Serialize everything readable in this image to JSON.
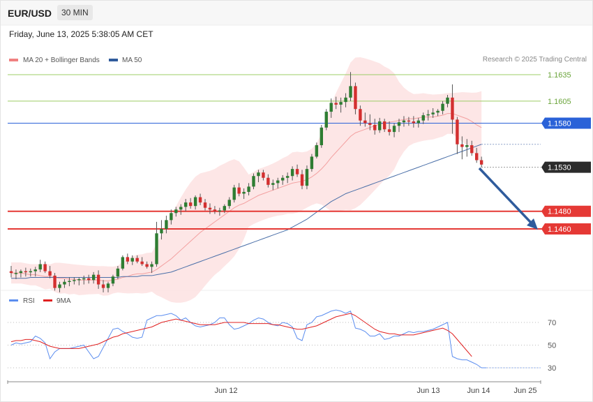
{
  "header": {
    "symbol": "EUR/USD",
    "timeframe": "30 MIN",
    "datetime": "Friday, June 13, 2025 5:38:05 AM CET"
  },
  "price_panel": {
    "legend": {
      "ma20": {
        "label": "MA 20 + Bollinger Bands",
        "color": "#f08080"
      },
      "ma50": {
        "label": "MA 50",
        "color": "#2f5b9c"
      }
    },
    "credit": "Research © 2025 Trading Central"
  },
  "rsi_panel": {
    "legend": {
      "rsi": {
        "label": "RSI",
        "color": "#5b8def"
      },
      "ma9": {
        "label": "9MA",
        "color": "#e02020"
      }
    }
  },
  "colors": {
    "up_candle": "#2e7d32",
    "down_candle": "#d32f2f",
    "band_fill": "#fde3e3",
    "resistance_green": "#9ccc65",
    "pivot_blue": "#2a62d8",
    "support_red": "#e53935",
    "last_price_bg": "#2b2b2b",
    "forecast_arrow": "#2f5b9c"
  },
  "chart_data": [
    {
      "type": "candlestick",
      "title": "EUR/USD 30 MIN",
      "price_levels": [
        {
          "value": 1.1635,
          "label": "1.1635",
          "style": "resistance",
          "color": "#9ccc65"
        },
        {
          "value": 1.1605,
          "label": "1.1605",
          "style": "resistance",
          "color": "#9ccc65"
        },
        {
          "value": 1.158,
          "label": "1.1580",
          "style": "pivot",
          "color": "#2a62d8"
        },
        {
          "value": 1.153,
          "label": "1.1530",
          "style": "last",
          "color": "#2b2b2b"
        },
        {
          "value": 1.148,
          "label": "1.1480",
          "style": "support",
          "color": "#e53935"
        },
        {
          "value": 1.146,
          "label": "1.1460",
          "style": "support",
          "color": "#e53935"
        }
      ],
      "x_labels": [
        "Jun 12",
        "Jun 13",
        "Jun 14",
        "Jun 25"
      ],
      "ylim": [
        1.1415,
        1.1645
      ],
      "ohlc": [
        [
          1.1412,
          1.1418,
          1.1405,
          1.141
        ],
        [
          1.141,
          1.1414,
          1.1403,
          1.141
        ],
        [
          1.141,
          1.1414,
          1.1405,
          1.1412
        ],
        [
          1.1412,
          1.1416,
          1.1406,
          1.1411
        ],
        [
          1.1411,
          1.1415,
          1.1406,
          1.1412
        ],
        [
          1.1412,
          1.1417,
          1.1406,
          1.1414
        ],
        [
          1.1414,
          1.1425,
          1.1411,
          1.142
        ],
        [
          1.142,
          1.1423,
          1.141,
          1.1412
        ],
        [
          1.1412,
          1.1418,
          1.1404,
          1.1407
        ],
        [
          1.1407,
          1.141,
          1.139,
          1.1393
        ],
        [
          1.1393,
          1.14,
          1.1388,
          1.1397
        ],
        [
          1.1397,
          1.1403,
          1.1393,
          1.14
        ],
        [
          1.14,
          1.1405,
          1.1395,
          1.1401
        ],
        [
          1.1401,
          1.1405,
          1.1397,
          1.1402
        ],
        [
          1.1402,
          1.1405,
          1.1396,
          1.1403
        ],
        [
          1.1403,
          1.1407,
          1.1397,
          1.1404
        ],
        [
          1.1404,
          1.1408,
          1.1398,
          1.1402
        ],
        [
          1.1402,
          1.1411,
          1.1398,
          1.1408
        ],
        [
          1.1408,
          1.1413,
          1.1392,
          1.1397
        ],
        [
          1.1397,
          1.1402,
          1.1388,
          1.1393
        ],
        [
          1.1393,
          1.14,
          1.1388,
          1.1398
        ],
        [
          1.1398,
          1.1408,
          1.1395,
          1.1406
        ],
        [
          1.1406,
          1.1418,
          1.1403,
          1.1415
        ],
        [
          1.1415,
          1.143,
          1.1413,
          1.1428
        ],
        [
          1.1428,
          1.1432,
          1.142,
          1.1423
        ],
        [
          1.1423,
          1.143,
          1.1419,
          1.1427
        ],
        [
          1.1427,
          1.143,
          1.1421,
          1.1423
        ],
        [
          1.1423,
          1.1428,
          1.1418,
          1.142
        ],
        [
          1.142,
          1.1423,
          1.1415,
          1.1417
        ],
        [
          1.1417,
          1.1423,
          1.141,
          1.142
        ],
        [
          1.142,
          1.1468,
          1.1417,
          1.1455
        ],
        [
          1.1455,
          1.147,
          1.1448,
          1.146
        ],
        [
          1.146,
          1.1475,
          1.1455,
          1.147
        ],
        [
          1.147,
          1.1482,
          1.1465,
          1.1478
        ],
        [
          1.1478,
          1.1485,
          1.1474,
          1.1482
        ],
        [
          1.1482,
          1.1488,
          1.1476,
          1.1485
        ],
        [
          1.1485,
          1.1494,
          1.148,
          1.149
        ],
        [
          1.149,
          1.1495,
          1.1483,
          1.1486
        ],
        [
          1.1486,
          1.1498,
          1.1482,
          1.1496
        ],
        [
          1.1496,
          1.15,
          1.1487,
          1.149
        ],
        [
          1.149,
          1.1494,
          1.1481,
          1.1484
        ],
        [
          1.1484,
          1.1489,
          1.1477,
          1.1482
        ],
        [
          1.1482,
          1.1486,
          1.1477,
          1.148
        ],
        [
          1.148,
          1.1484,
          1.1475,
          1.1481
        ],
        [
          1.1481,
          1.1488,
          1.1478,
          1.1486
        ],
        [
          1.1486,
          1.1496,
          1.1483,
          1.1493
        ],
        [
          1.1493,
          1.151,
          1.149,
          1.1507
        ],
        [
          1.1507,
          1.1512,
          1.1497,
          1.15
        ],
        [
          1.15,
          1.1506,
          1.1494,
          1.1502
        ],
        [
          1.1502,
          1.1512,
          1.1498,
          1.1508
        ],
        [
          1.1508,
          1.1523,
          1.1505,
          1.152
        ],
        [
          1.152,
          1.1527,
          1.1513,
          1.1524
        ],
        [
          1.1524,
          1.1527,
          1.1515,
          1.1518
        ],
        [
          1.1518,
          1.1522,
          1.1507,
          1.151
        ],
        [
          1.151,
          1.1516,
          1.1504,
          1.1512
        ],
        [
          1.1512,
          1.1518,
          1.1506,
          1.1515
        ],
        [
          1.1515,
          1.1521,
          1.151,
          1.1518
        ],
        [
          1.1518,
          1.1524,
          1.1512,
          1.152
        ],
        [
          1.152,
          1.1531,
          1.1515,
          1.1528
        ],
        [
          1.1528,
          1.1533,
          1.1519,
          1.1522
        ],
        [
          1.1522,
          1.1527,
          1.1505,
          1.1509
        ],
        [
          1.1509,
          1.1532,
          1.1505,
          1.1528
        ],
        [
          1.1528,
          1.1545,
          1.1525,
          1.1542
        ],
        [
          1.1542,
          1.1558,
          1.154,
          1.1555
        ],
        [
          1.1555,
          1.1578,
          1.1552,
          1.1575
        ],
        [
          1.1575,
          1.1596,
          1.1572,
          1.1593
        ],
        [
          1.1593,
          1.1608,
          1.1586,
          1.1603
        ],
        [
          1.1603,
          1.161,
          1.1596,
          1.1601
        ],
        [
          1.1601,
          1.1609,
          1.1592,
          1.1604
        ],
        [
          1.1604,
          1.1614,
          1.1598,
          1.1609
        ],
        [
          1.1609,
          1.1638,
          1.1605,
          1.1622
        ],
        [
          1.1622,
          1.1626,
          1.159,
          1.1596
        ],
        [
          1.1596,
          1.16,
          1.1577,
          1.1583
        ],
        [
          1.1583,
          1.1592,
          1.1576,
          1.158
        ],
        [
          1.158,
          1.159,
          1.1572,
          1.1578
        ],
        [
          1.1578,
          1.1585,
          1.1567,
          1.1572
        ],
        [
          1.1572,
          1.1586,
          1.1569,
          1.1582
        ],
        [
          1.1582,
          1.1585,
          1.157,
          1.1573
        ],
        [
          1.1573,
          1.1582,
          1.1566,
          1.157
        ],
        [
          1.157,
          1.158,
          1.1564,
          1.1577
        ],
        [
          1.1577,
          1.1585,
          1.157,
          1.1581
        ],
        [
          1.1581,
          1.1588,
          1.1576,
          1.1583
        ],
        [
          1.1583,
          1.1587,
          1.1577,
          1.1582
        ],
        [
          1.1582,
          1.1588,
          1.1575,
          1.158
        ],
        [
          1.158,
          1.1586,
          1.1575,
          1.1583
        ],
        [
          1.1583,
          1.1592,
          1.1579,
          1.1589
        ],
        [
          1.1589,
          1.1595,
          1.1583,
          1.159
        ],
        [
          1.159,
          1.1597,
          1.1586,
          1.1592
        ],
        [
          1.1592,
          1.1596,
          1.1588,
          1.1594
        ],
        [
          1.1594,
          1.1605,
          1.159,
          1.1602
        ],
        [
          1.1602,
          1.1612,
          1.1598,
          1.1609
        ],
        [
          1.1609,
          1.1624,
          1.1568,
          1.1584
        ],
        [
          1.1584,
          1.1587,
          1.1545,
          1.1556
        ],
        [
          1.1556,
          1.1565,
          1.1539,
          1.1553
        ],
        [
          1.1553,
          1.1562,
          1.1542,
          1.1555
        ],
        [
          1.1555,
          1.156,
          1.1543,
          1.1546
        ],
        [
          1.1546,
          1.1552,
          1.1535,
          1.1538
        ],
        [
          1.1538,
          1.1542,
          1.153,
          1.1533
        ]
      ],
      "series": [
        {
          "name": "MA 20 + Bollinger Bands",
          "values": [
            1.141,
            1.141,
            1.141,
            1.1409,
            1.1408,
            1.1408,
            1.1407,
            1.1406,
            1.1406,
            1.1405,
            1.1404,
            1.1404,
            1.1403,
            1.1403,
            1.1402,
            1.1402,
            1.1402,
            1.1402,
            1.1402,
            1.1401,
            1.1401,
            1.1402,
            1.1403,
            1.1405,
            1.1406,
            1.1408,
            1.1409,
            1.1409,
            1.141,
            1.1411,
            1.1414,
            1.1418,
            1.1422,
            1.1426,
            1.1431,
            1.1436,
            1.1441,
            1.1446,
            1.1451,
            1.1456,
            1.146,
            1.1464,
            1.1468,
            1.1472,
            1.1476,
            1.148,
            1.1484,
            1.1487,
            1.1489,
            1.1492,
            1.1495,
            1.1498,
            1.15,
            1.1502,
            1.1504,
            1.1506,
            1.1508,
            1.151,
            1.1512,
            1.1513,
            1.1514,
            1.1516,
            1.1519,
            1.1523,
            1.1528,
            1.1534,
            1.1541,
            1.1547,
            1.1553,
            1.1559,
            1.1565,
            1.1569,
            1.1571,
            1.1573,
            1.1575,
            1.1577,
            1.1579,
            1.158,
            1.1581,
            1.1582,
            1.1583,
            1.1584,
            1.1585,
            1.1585,
            1.1586,
            1.1587,
            1.1587,
            1.1587,
            1.1588,
            1.1589,
            1.1591,
            1.1591,
            1.1589,
            1.1587,
            1.1585,
            1.1582,
            1.1578,
            1.1575
          ]
        },
        {
          "name": "MA 50",
          "values": [
            1.1404,
            1.1404,
            1.1404,
            1.1404,
            1.1405,
            1.1405,
            1.1405,
            1.1405,
            1.1405,
            1.1405,
            1.1405,
            1.1405,
            1.1405,
            1.1405,
            1.1405,
            1.1405,
            1.1405,
            1.1405,
            1.1405,
            1.1405,
            1.1405,
            1.1405,
            1.1405,
            1.1406,
            1.1406,
            1.1406,
            1.1406,
            1.1407,
            1.1407,
            1.1407,
            1.1408,
            1.1409,
            1.141,
            1.1411,
            1.1413,
            1.1415,
            1.1417,
            1.1419,
            1.1421,
            1.1423,
            1.1425,
            1.1427,
            1.1429,
            1.1431,
            1.1433,
            1.1435,
            1.1437,
            1.1439,
            1.1441,
            1.1443,
            1.1445,
            1.1447,
            1.1449,
            1.1451,
            1.1453,
            1.1455,
            1.1457,
            1.1459,
            1.1462,
            1.1465,
            1.1468,
            1.1471,
            1.1475,
            1.1479,
            1.1483,
            1.1487,
            1.1491,
            1.1494,
            1.1497,
            1.15,
            1.1502,
            1.1504,
            1.1506,
            1.1508,
            1.151,
            1.1512,
            1.1514,
            1.1516,
            1.1518,
            1.152,
            1.1522,
            1.1524,
            1.1526,
            1.1528,
            1.153,
            1.1532,
            1.1534,
            1.1536,
            1.1538,
            1.154,
            1.1542,
            1.1544,
            1.1546,
            1.1548,
            1.155,
            1.1552,
            1.1554,
            1.1556
          ]
        }
      ]
    },
    {
      "type": "line",
      "title": "RSI",
      "y_ticks": [
        30,
        50,
        70
      ],
      "ylim": [
        20,
        80
      ],
      "series": [
        {
          "name": "RSI",
          "values": [
            50,
            52,
            51,
            52,
            53,
            58,
            56,
            52,
            38,
            44,
            47,
            47,
            47,
            48,
            49,
            50,
            44,
            38,
            40,
            48,
            56,
            64,
            65,
            62,
            60,
            57,
            56,
            57,
            72,
            74,
            76,
            76,
            77,
            78,
            76,
            72,
            74,
            70,
            67,
            66,
            67,
            68,
            70,
            74,
            74,
            68,
            64,
            65,
            67,
            69,
            72,
            74,
            73,
            70,
            68,
            67,
            70,
            69,
            66,
            56,
            54,
            68,
            70,
            75,
            76,
            78,
            80,
            81,
            80,
            78,
            80,
            65,
            64,
            62,
            58,
            58,
            60,
            55,
            56,
            58,
            58,
            60,
            62,
            61,
            62,
            62,
            63,
            64,
            66,
            68,
            70,
            40,
            38,
            37,
            37,
            35,
            33,
            30,
            30
          ]
        },
        {
          "name": "9MA",
          "values": [
            53,
            54,
            54,
            55,
            55,
            54,
            53,
            51,
            49,
            48,
            47,
            47,
            47,
            47,
            47,
            48,
            49,
            50,
            51,
            53,
            55,
            57,
            58,
            60,
            61,
            62,
            63,
            64,
            65,
            66,
            68,
            70,
            71,
            72,
            73,
            72,
            71,
            70,
            69,
            68,
            68,
            68,
            68,
            69,
            70,
            70,
            70,
            70,
            70,
            69,
            69,
            69,
            69,
            69,
            68,
            68,
            67,
            66,
            65,
            64,
            64,
            65,
            66,
            67,
            69,
            71,
            73,
            75,
            76,
            77,
            78,
            76,
            73,
            70,
            67,
            64,
            62,
            61,
            60,
            60,
            59,
            59,
            59,
            59,
            60,
            61,
            62,
            63,
            64,
            65,
            63,
            60,
            55,
            50,
            45,
            40
          ]
        }
      ]
    }
  ]
}
